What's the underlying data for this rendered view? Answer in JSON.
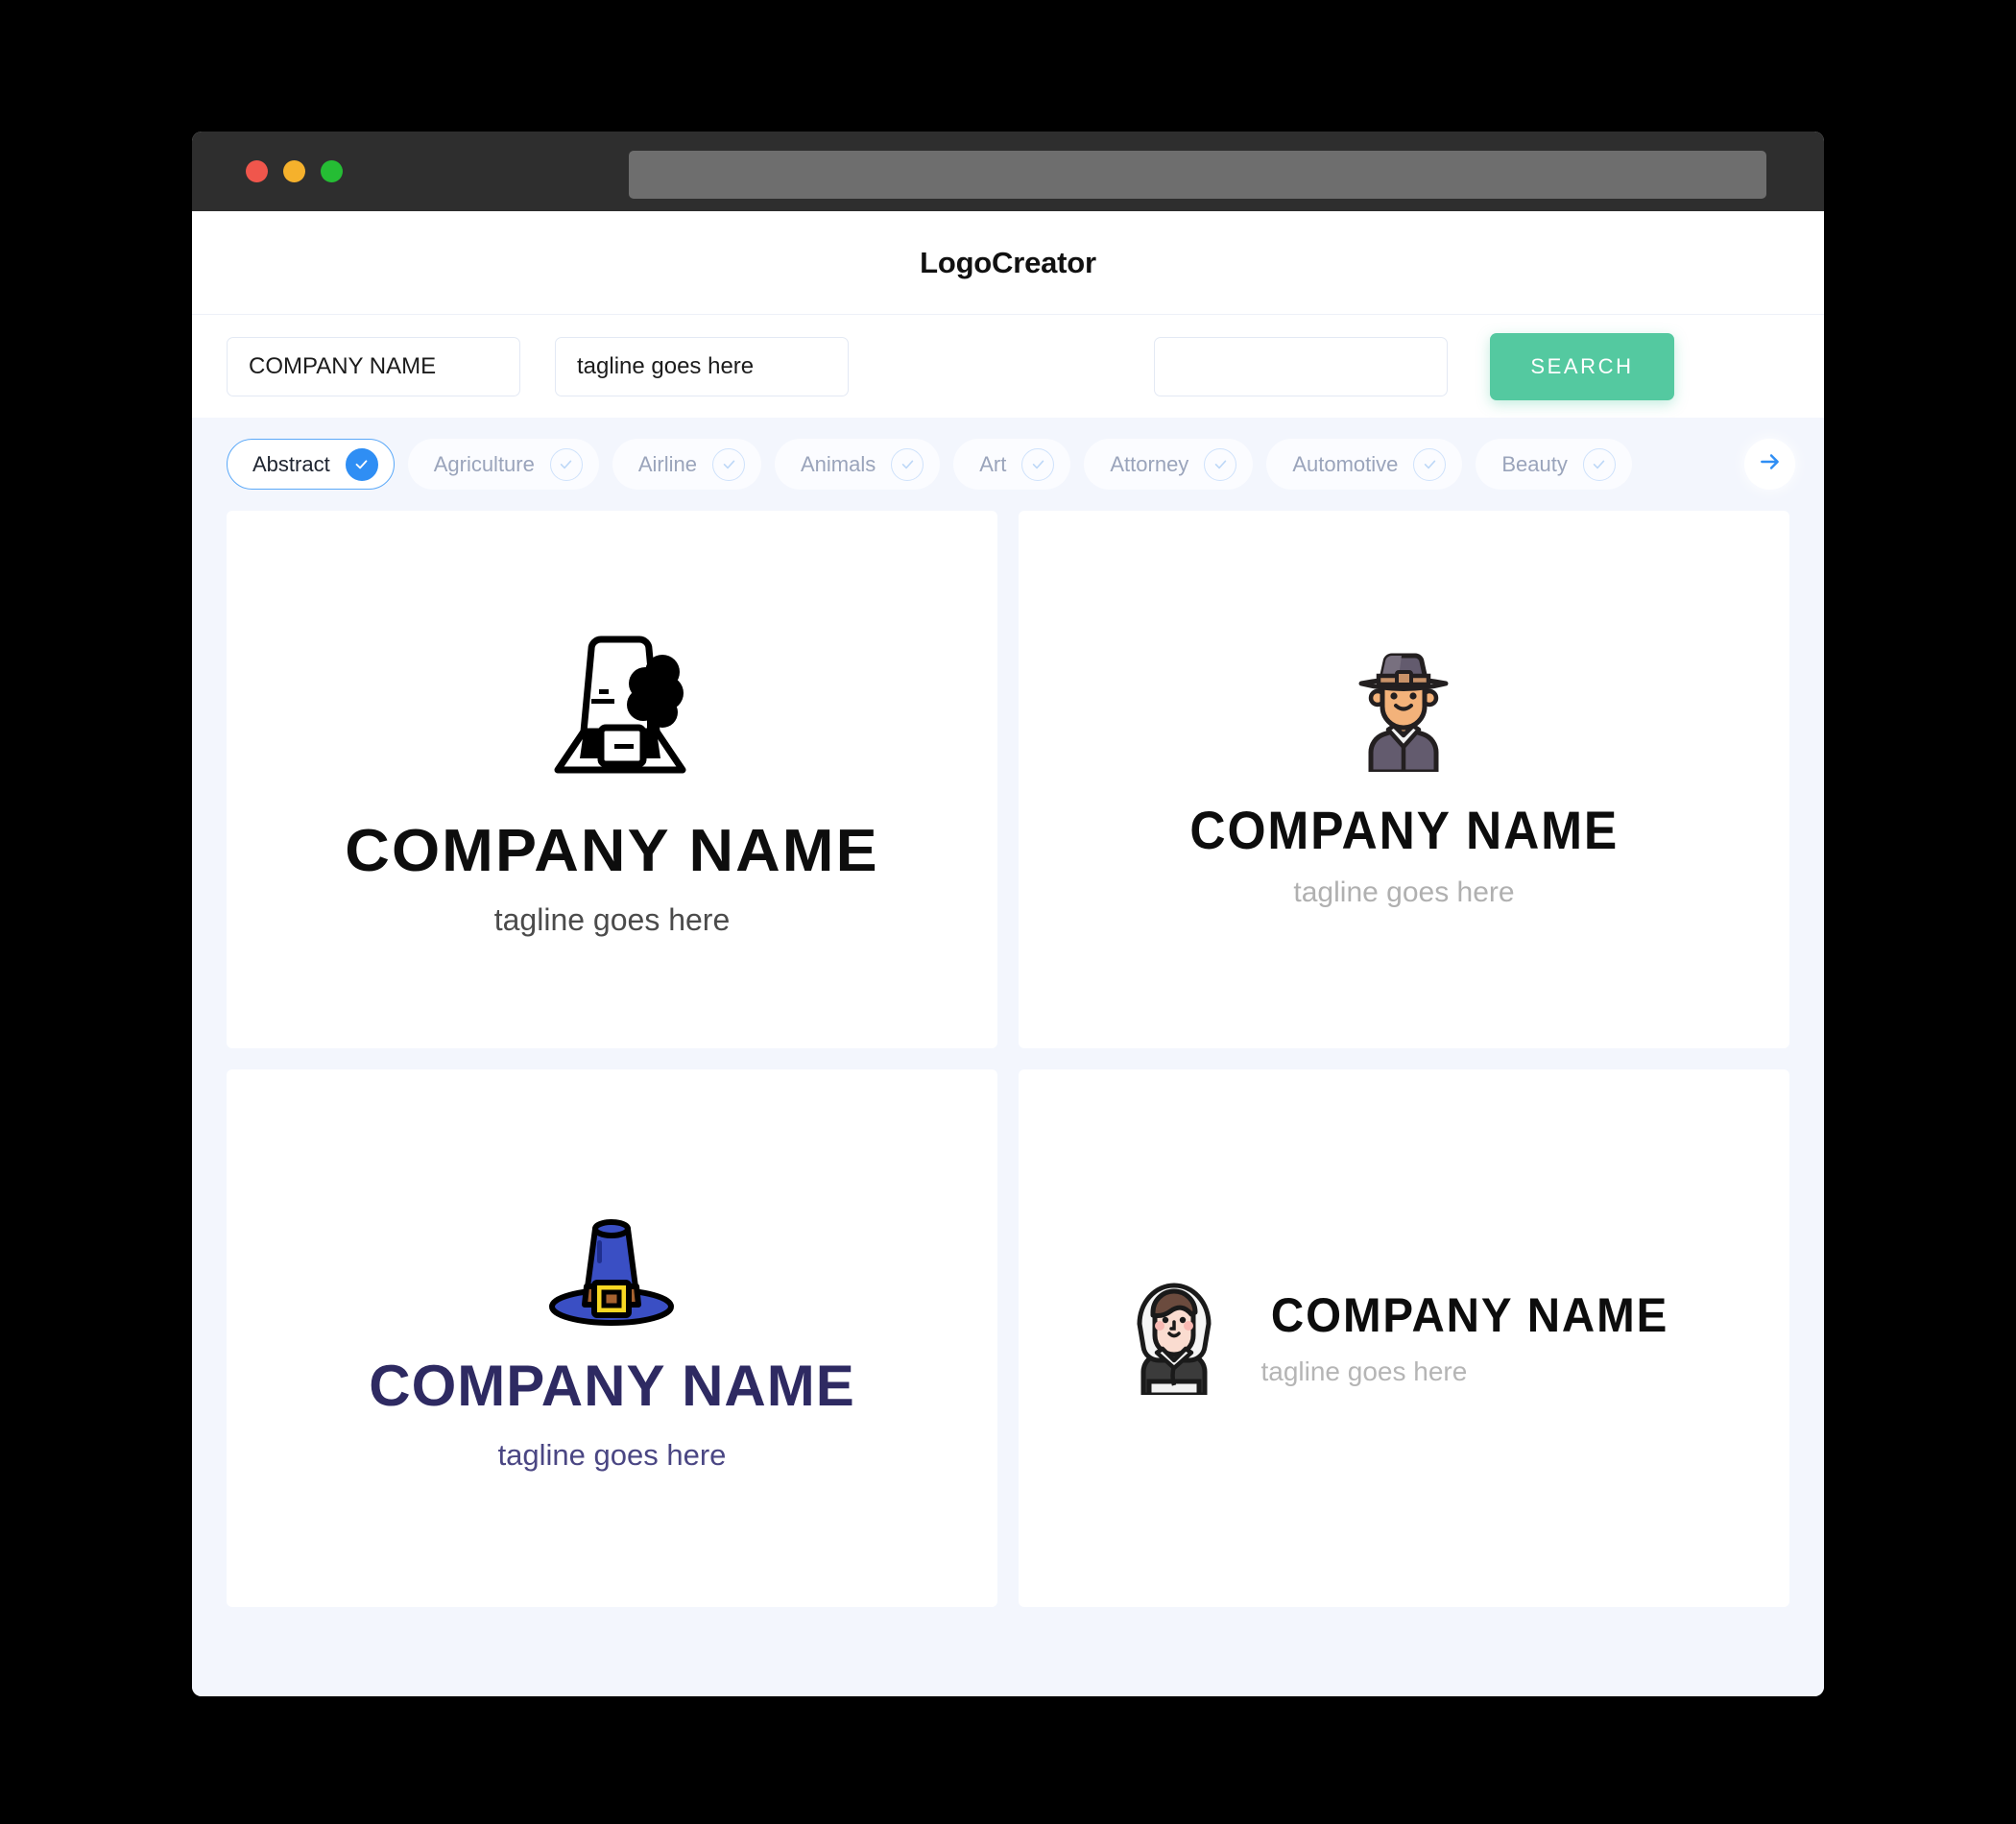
{
  "window": {
    "traffic_lights": [
      "close",
      "minimize",
      "maximize"
    ],
    "url_value": "",
    "colors": {
      "close": "#f0564c",
      "minimize": "#f5b12c",
      "maximize": "#25bd34",
      "titlebar": "#2e2e2e"
    }
  },
  "header": {
    "title": "LogoCreator"
  },
  "search": {
    "company_value": "COMPANY NAME",
    "company_placeholder": "COMPANY NAME",
    "tagline_value": "tagline goes here",
    "tagline_placeholder": "tagline goes here",
    "keyword_value": "",
    "keyword_placeholder": "",
    "button_label": "SEARCH",
    "button_color": "#54c9a0"
  },
  "categories": {
    "next_label": "next",
    "items": [
      {
        "label": "Abstract",
        "selected": true
      },
      {
        "label": "Agriculture",
        "selected": false
      },
      {
        "label": "Airline",
        "selected": false
      },
      {
        "label": "Animals",
        "selected": false
      },
      {
        "label": "Art",
        "selected": false
      },
      {
        "label": "Attorney",
        "selected": false
      },
      {
        "label": "Automotive",
        "selected": false
      },
      {
        "label": "Beauty",
        "selected": false
      }
    ]
  },
  "results": [
    {
      "icon": "pilgrim-hat-tree-icon",
      "company": "COMPANY NAME",
      "tagline": "tagline goes here",
      "name_color": "#0d0d0d",
      "tagline_color": "#4b4b4b",
      "layout": "vertical"
    },
    {
      "icon": "pilgrim-man-icon",
      "company": "COMPANY NAME",
      "tagline": "tagline goes here",
      "name_color": "#0d0d0d",
      "tagline_color": "#b0b0b0",
      "layout": "vertical"
    },
    {
      "icon": "blue-pilgrim-hat-icon",
      "company": "COMPANY NAME",
      "tagline": "tagline goes here",
      "name_color": "#2e2a62",
      "tagline_color": "#4a4683",
      "layout": "vertical"
    },
    {
      "icon": "pilgrim-woman-icon",
      "company": "COMPANY NAME",
      "tagline": "tagline goes here",
      "name_color": "#0d0d0d",
      "tagline_color": "#b5b5b5",
      "layout": "horizontal"
    }
  ]
}
